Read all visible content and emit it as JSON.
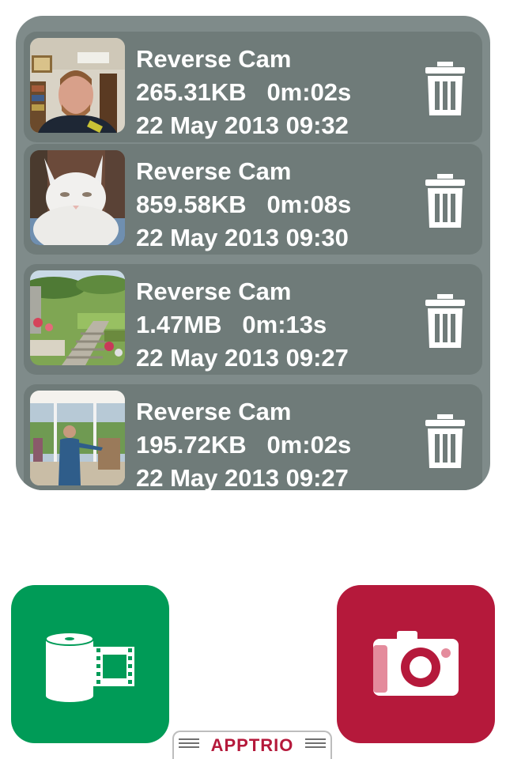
{
  "videos": [
    {
      "title": "Reverse Cam",
      "size": "265.31KB",
      "duration": "0m:02s",
      "date": "22 May 2013 09:32",
      "thumb": "man-selfie"
    },
    {
      "title": "Reverse Cam",
      "size": "859.58KB",
      "duration": "0m:08s",
      "date": "22 May 2013 09:30",
      "thumb": "white-cat"
    },
    {
      "title": "Reverse Cam",
      "size": "1.47MB",
      "duration": "0m:13s",
      "date": "22 May 2013 09:27",
      "thumb": "garden"
    },
    {
      "title": "Reverse Cam",
      "size": "195.72KB",
      "duration": "0m:02s",
      "date": "22 May 2013 09:27",
      "thumb": "woman-doorway"
    }
  ],
  "actions": {
    "videos_button_icon": "film-roll-icon",
    "camera_button_icon": "camera-icon",
    "delete_icon": "trash-icon"
  },
  "branding": {
    "logo_text": "APPTRIO"
  },
  "colors": {
    "panel": "#7f8b8a",
    "row": "#6f7b79",
    "green": "#009b57",
    "red": "#b5193b",
    "text": "#ffffff"
  }
}
